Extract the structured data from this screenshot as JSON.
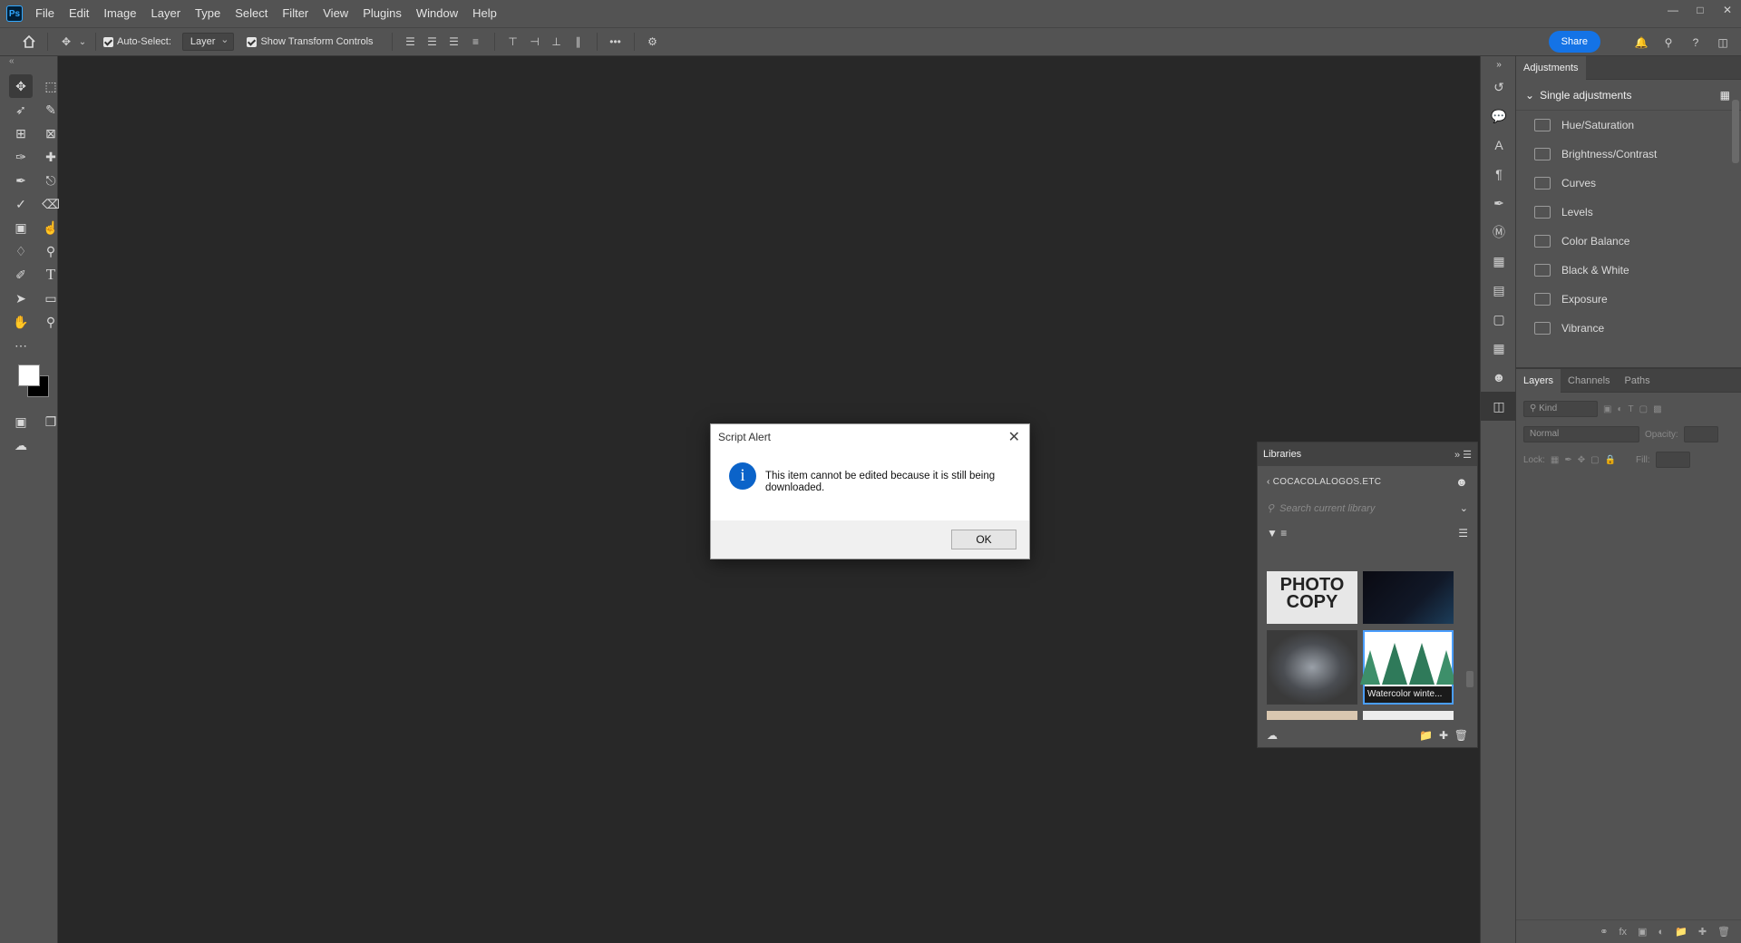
{
  "app": {
    "logo": "Ps"
  },
  "menubar": {
    "items": [
      "File",
      "Edit",
      "Image",
      "Layer",
      "Type",
      "Select",
      "Filter",
      "View",
      "Plugins",
      "Window",
      "Help"
    ]
  },
  "options_bar": {
    "auto_select_label": "Auto-Select:",
    "auto_select_checked": true,
    "layer_select_value": "Layer",
    "show_transform_label": "Show Transform Controls",
    "show_transform_checked": true,
    "share_label": "Share"
  },
  "adjustments": {
    "tab": "Adjustments",
    "section": "Single adjustments",
    "items": [
      "Hue/Saturation",
      "Brightness/Contrast",
      "Curves",
      "Levels",
      "Color Balance",
      "Black & White",
      "Exposure",
      "Vibrance"
    ]
  },
  "layers": {
    "tabs": [
      "Layers",
      "Channels",
      "Paths"
    ],
    "kind_placeholder": "Kind",
    "blend_mode": "Normal",
    "opacity_label": "Opacity:",
    "lock_label": "Lock:",
    "fill_label": "Fill:"
  },
  "libraries": {
    "title": "Libraries",
    "library_name": "COCACOLALOGOS.ETC",
    "search_placeholder": "Search current library",
    "thumb_photocopy_text": "PHOTO COPY",
    "selected_item_label": "Watercolor winte..."
  },
  "dialog": {
    "title": "Script Alert",
    "message": "This item cannot be edited because it is still being downloaded.",
    "ok_label": "OK",
    "icon_glyph": "i"
  }
}
